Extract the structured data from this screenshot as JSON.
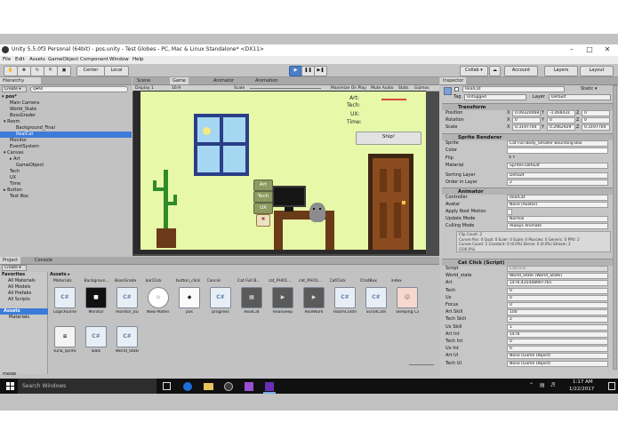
{
  "window": {
    "title": "Unity 5.5.0f3 Personal (64bit) - pos.unity - Test Globes - PC, Mac & Linux Standalone* <DX11>"
  },
  "menu": [
    "File",
    "Edit",
    "Assets",
    "GameObject",
    "Component",
    "Window",
    "Help"
  ],
  "toolbar": {
    "center": "Center",
    "local": "Local",
    "collab": "Collab ▾",
    "account": "Account",
    "layers": "Layers",
    "layout": "Layout"
  },
  "hierarchy": {
    "tab": "Hierarchy",
    "create": "Create ▾",
    "search_placeholder": "Q▾All",
    "scene": "pos*",
    "items": [
      {
        "label": "Main Camera",
        "indent": 1,
        "selected": false
      },
      {
        "label": "World_State",
        "indent": 1,
        "selected": false
      },
      {
        "label": "BossGrader",
        "indent": 1,
        "selected": false
      },
      {
        "label": "▾ Room",
        "indent": 0,
        "selected": false
      },
      {
        "label": "Background_Final",
        "indent": 2,
        "selected": false
      },
      {
        "label": "RealCat",
        "indent": 2,
        "selected": true
      },
      {
        "label": "Monitor",
        "indent": 1,
        "selected": false
      },
      {
        "label": "EventSystem",
        "indent": 1,
        "selected": false
      },
      {
        "label": "▾ Canvas",
        "indent": 0,
        "selected": false
      },
      {
        "label": "▸ Art",
        "indent": 1,
        "selected": false
      },
      {
        "label": "GameObject",
        "indent": 2,
        "selected": false
      },
      {
        "label": "Tech",
        "indent": 1,
        "selected": false
      },
      {
        "label": "UX",
        "indent": 1,
        "selected": false
      },
      {
        "label": "Time",
        "indent": 1,
        "selected": false
      },
      {
        "label": "▸ Button",
        "indent": 0,
        "selected": false
      },
      {
        "label": "Text Box",
        "indent": 1,
        "selected": false
      }
    ]
  },
  "views": {
    "tabs": [
      "Scene",
      "Game",
      "Animator",
      "Animation"
    ],
    "display": "Display 1",
    "aspect": "16:9",
    "scale_label": "Scale",
    "options": [
      "Maximize On Play",
      "Mute Audio",
      "Stats",
      "Gizmos"
    ]
  },
  "game": {
    "hud": [
      "Art:",
      "Tech:",
      "UX:",
      "Time:"
    ],
    "ship_button": "Ship!",
    "side_buttons": [
      "Art",
      "Tech",
      "UX"
    ]
  },
  "project": {
    "tabs": [
      "Project",
      "Console"
    ],
    "create": "Create ▾",
    "favorites": [
      "Favorites",
      "All Materials",
      "All Models",
      "All Prefabs",
      "All Scripts"
    ],
    "assets_tree": [
      "Assets",
      "Materials"
    ],
    "breadcrumb": "Assets ▸",
    "column_headers": [
      "Materials",
      "Backgroun...",
      "BossGrade",
      "barClick",
      "button_click",
      "Cancel",
      "Cat Full B...",
      "cat_PHO1...",
      "cat_PHO1...",
      "CatClick",
      "ChatBox",
      "index"
    ],
    "assets": [
      {
        "label": "LogicRunner",
        "kind": "cs"
      },
      {
        "label": "Monitor",
        "kind": "monitor"
      },
      {
        "label": "monitor_but...",
        "kind": "cs"
      },
      {
        "label": "New Materi...",
        "kind": "sphere"
      },
      {
        "label": "pos",
        "kind": "unity"
      },
      {
        "label": "progress",
        "kind": "cs"
      },
      {
        "label": "RealCat",
        "kind": "prefab"
      },
      {
        "label": "RealSleep",
        "kind": "anim"
      },
      {
        "label": "RealWork",
        "kind": "anim"
      },
      {
        "label": "RoomControl...",
        "kind": "cs"
      },
      {
        "label": "ScrollCam",
        "kind": "cs"
      },
      {
        "label": "Sleeping Cat",
        "kind": "cat"
      },
      {
        "label": "tuna_sprite",
        "kind": "tuna"
      },
      {
        "label": "walk",
        "kind": "cs"
      },
      {
        "label": "World_State",
        "kind": "cs"
      }
    ],
    "status": "meow"
  },
  "inspector": {
    "tab": "Inspector",
    "object_name": "RealCat",
    "static": "Static ▾",
    "tag_label": "Tag",
    "tag": "Untagged",
    "layer_label": "Layer",
    "layer": "Default",
    "transform": {
      "title": "Transform",
      "rows": [
        {
          "label": "Position",
          "x": "0.09320068",
          "y": "-1.466431",
          "z": "0"
        },
        {
          "label": "Rotation",
          "x": "0",
          "y": "0",
          "z": "0"
        },
        {
          "label": "Scale",
          "x": "0.3197704",
          "y": "0.2962929",
          "z": "0.3197704"
        }
      ]
    },
    "sprite_renderer": {
      "title": "Sprite Renderer",
      "rows": [
        {
          "label": "Sprite",
          "value": "Cat Full Body_Smaller Bounding Box"
        },
        {
          "label": "Color",
          "value": ""
        },
        {
          "label": "Flip",
          "value": "X   Y"
        },
        {
          "label": "Material",
          "value": "Sprites-Default"
        },
        {
          "label": "Sorting Layer",
          "value": "Default"
        },
        {
          "label": "Order in Layer",
          "value": "2"
        }
      ]
    },
    "animator": {
      "title": "Animator",
      "rows": [
        {
          "label": "Controller",
          "value": "RealCat"
        },
        {
          "label": "Avatar",
          "value": "None (Avatar)"
        },
        {
          "label": "Apply Root Motion",
          "value": ""
        },
        {
          "label": "Update Mode",
          "value": "Normal"
        },
        {
          "label": "Culling Mode",
          "value": "Always Animate"
        }
      ],
      "info": [
        "Clip Count: 2",
        "Curves Pos: 0 Quat: 0 Euler: 0 Scale: 0 Muscles: 0 Generic: 0 PPtr: 2",
        "Curves Count: 2 Constant: 0 (0.0%) Dense: 0 (0.0%) Stream: 2",
        "(100.0%)"
      ]
    },
    "cat_click": {
      "title": "Cat Click (Script)",
      "rows": [
        {
          "label": "Script",
          "value": "CatClick"
        },
        {
          "label": "World_state",
          "value": "World_State (World_State)"
        },
        {
          "label": "Art",
          "value": "1476.435448997765"
        },
        {
          "label": "Tech",
          "value": "0"
        },
        {
          "label": "Ux",
          "value": "0"
        },
        {
          "label": "Focus",
          "value": "0"
        },
        {
          "label": "Art Skill",
          "value": "100"
        },
        {
          "label": "Tech Skill",
          "value": "2"
        },
        {
          "label": "Ux Skill",
          "value": "1"
        },
        {
          "label": "Art Int",
          "value": "1476"
        },
        {
          "label": "Tech Int",
          "value": "0"
        },
        {
          "label": "Ux Int",
          "value": "0"
        },
        {
          "label": "Art UI",
          "value": "None (Game Object)"
        },
        {
          "label": "Tech UI",
          "value": "None (Game Object)"
        }
      ]
    }
  },
  "taskbar": {
    "search_placeholder": "Search Windows",
    "time": "1:17 AM",
    "date": "1/22/2017"
  },
  "colors": {
    "selection": "#3d7bd9",
    "play": "#4b7fc6",
    "game_bg": "#e7f8a9",
    "taskbar": "#101010"
  }
}
